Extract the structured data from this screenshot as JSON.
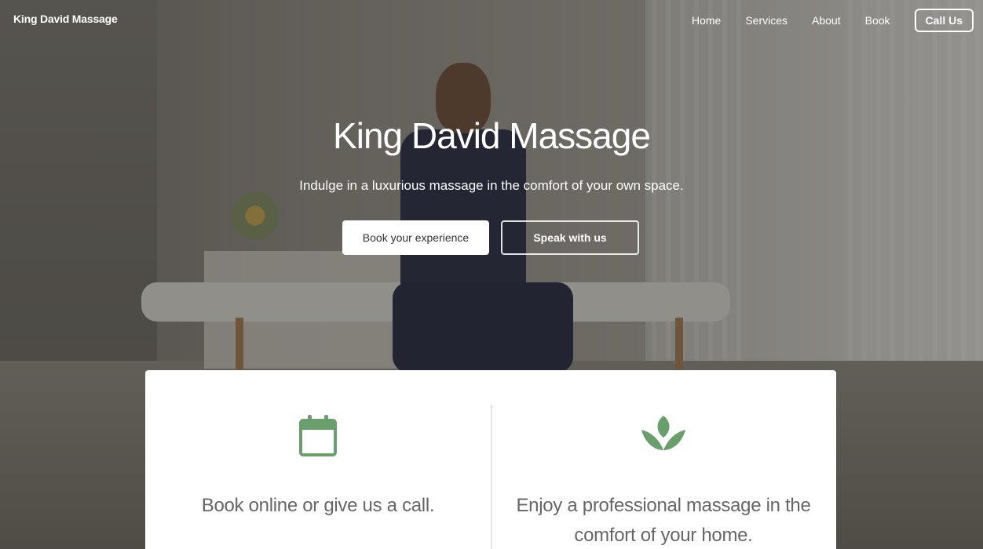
{
  "nav": {
    "brand": "King David Massage",
    "links": [
      "Home",
      "Services",
      "About",
      "Book"
    ],
    "call_label": "Call Us"
  },
  "hero": {
    "title": "King David Massage",
    "subtitle": "Indulge in a luxurious massage in the comfort of your own space.",
    "primary_button": "Book your experience",
    "secondary_button": "Speak with us"
  },
  "features": [
    {
      "icon": "calendar-icon",
      "text": "Book online or give us a call."
    },
    {
      "icon": "lotus-icon",
      "text": "Enjoy a professional massage in the comfort of your home."
    }
  ],
  "colors": {
    "accent_green": "#6a9e6c",
    "card_text": "#666666"
  }
}
